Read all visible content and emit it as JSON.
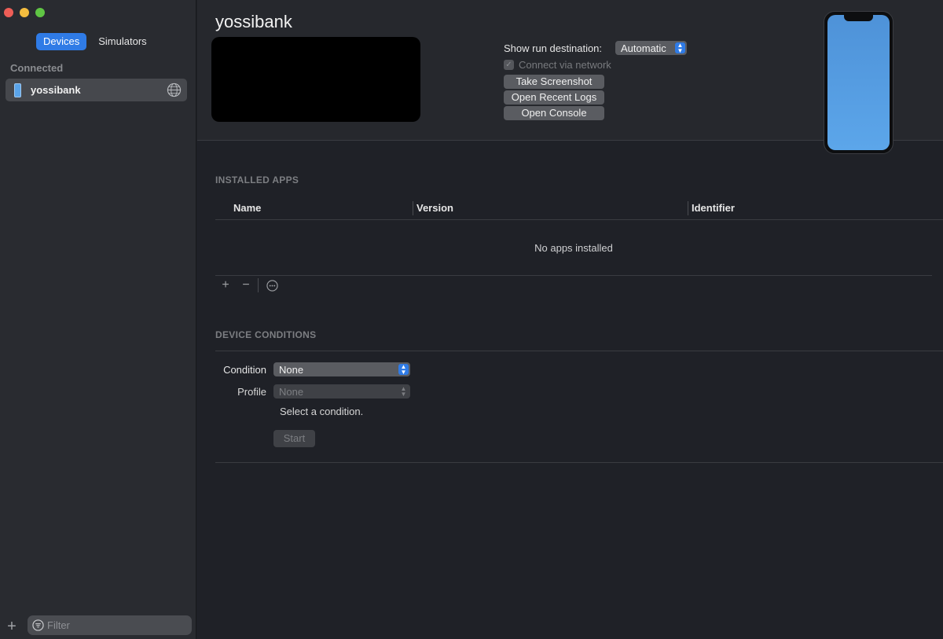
{
  "sidebar": {
    "tabs": [
      {
        "label": "Devices",
        "active": true
      },
      {
        "label": "Simulators",
        "active": false
      }
    ],
    "section_label": "Connected",
    "devices": [
      {
        "name": "yossibank",
        "icon": "iphone-icon",
        "status_icon": "globe-icon"
      }
    ],
    "filter_placeholder": "Filter"
  },
  "header": {
    "device_title": "yossibank",
    "run_destination_label": "Show run destination:",
    "run_destination_value": "Automatic",
    "connect_via_network_label": "Connect via network",
    "connect_via_network_checked": true,
    "buttons": {
      "take_screenshot": "Take Screenshot",
      "open_recent_logs": "Open Recent Logs",
      "open_console": "Open Console"
    }
  },
  "installed_apps": {
    "title": "INSTALLED APPS",
    "columns": [
      "Name",
      "Version",
      "Identifier"
    ],
    "empty_message": "No apps installed",
    "tools": {
      "add": "+",
      "remove": "−"
    }
  },
  "device_conditions": {
    "title": "DEVICE CONDITIONS",
    "condition_label": "Condition",
    "condition_value": "None",
    "profile_label": "Profile",
    "profile_value": "None",
    "hint": "Select a condition.",
    "start_label": "Start"
  },
  "colors": {
    "accent": "#2f7be6",
    "sidebar_bg": "#292b30",
    "main_bg": "#1f2127",
    "phone_screen": "#5ca6ea"
  }
}
